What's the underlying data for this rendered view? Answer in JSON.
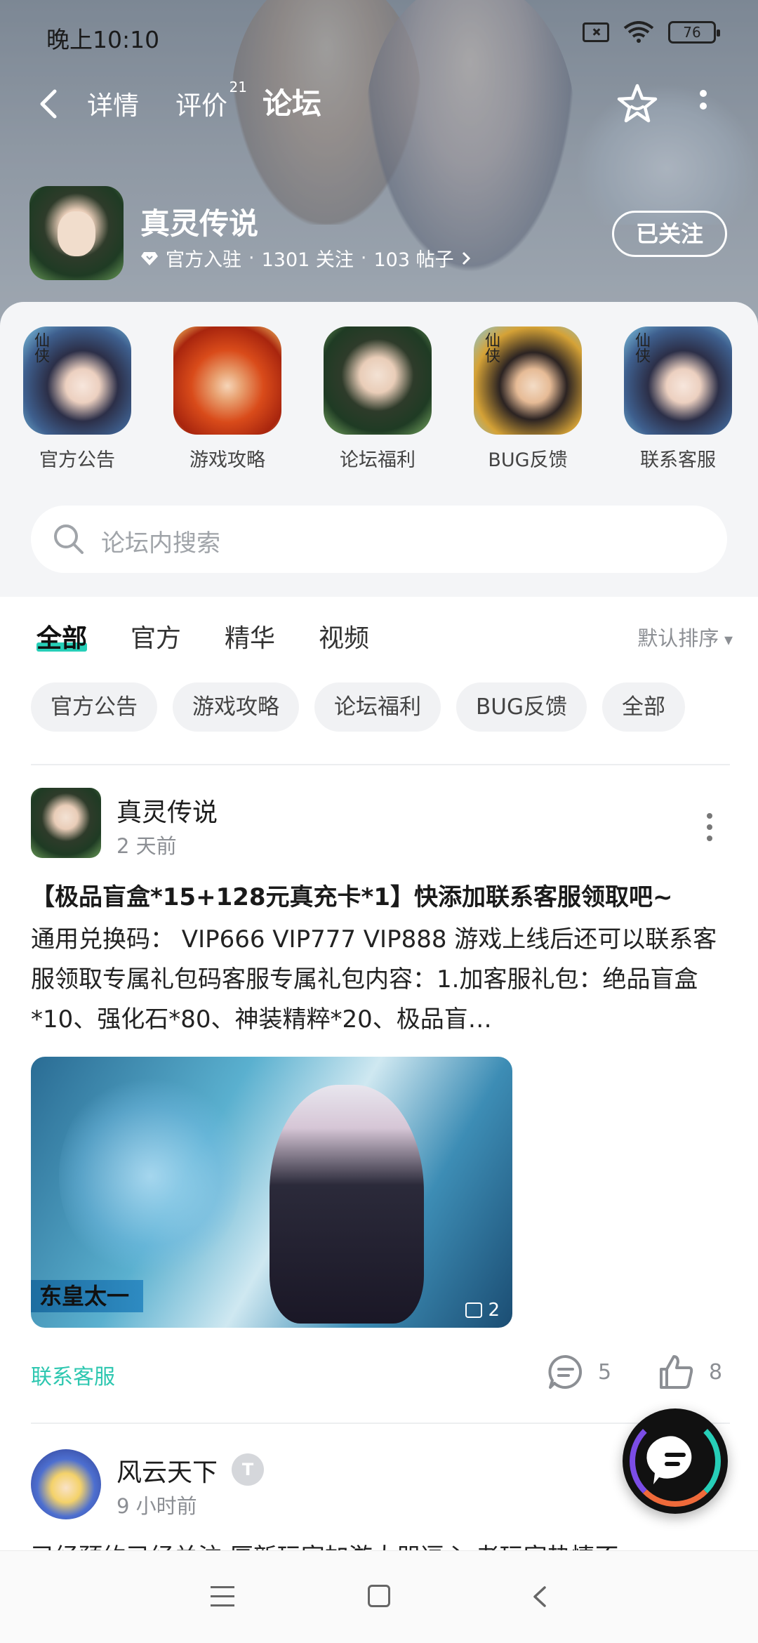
{
  "status": {
    "time": "晚上10:10",
    "battery": "76"
  },
  "nav": {
    "tabs": [
      {
        "label": "详情"
      },
      {
        "label": "评价",
        "badge": "21"
      },
      {
        "label": "论坛"
      }
    ],
    "active_tab": "论坛"
  },
  "game": {
    "name": "真灵传说",
    "verified": "官方入驻",
    "followers": "1301 关注",
    "posts": "103 帖子",
    "follow_button": "已关注"
  },
  "categories": [
    {
      "label": "官方公告",
      "icon": "heroine-blue",
      "tag": "仙侠"
    },
    {
      "label": "游戏攻略",
      "icon": "fire-demon"
    },
    {
      "label": "论坛福利",
      "icon": "heroine-green"
    },
    {
      "label": "BUG反馈",
      "icon": "hero-yellow",
      "tag": "仙侠"
    },
    {
      "label": "联系客服",
      "icon": "heroine-blue",
      "tag": "仙侠"
    }
  ],
  "search": {
    "placeholder": "论坛内搜索"
  },
  "filter_tabs": [
    {
      "label": "全部"
    },
    {
      "label": "官方"
    },
    {
      "label": "精华"
    },
    {
      "label": "视频"
    }
  ],
  "sort": "默认排序",
  "chips": [
    "官方公告",
    "游戏攻略",
    "论坛福利",
    "BUG反馈",
    "全部"
  ],
  "post1": {
    "author": "真灵传说",
    "time": "2 天前",
    "title": "【极品盲盒*15+128元真充卡*1】快添加联系客服领取吧~",
    "body": "通用兑换码： VIP666  VIP777  VIP888 游戏上线后还可以联系客服领取专属礼包码客服专属礼包内容：1.加客服礼包：绝品盲盒*10、强化石*80、神装精粹*20、极品盲…",
    "image_caption": "东皇太一",
    "image_count": "2",
    "topic": "联系客服",
    "comments": "5",
    "likes": "8"
  },
  "post2": {
    "author": "风云天下",
    "badge": "T",
    "time": "9 小时前",
    "text": "已经预约已经关注 厚新玩家加游大朋逗心 老玩家热情不"
  },
  "colors": {
    "accent": "#27cfb8",
    "topic": "#2ec7b0"
  }
}
